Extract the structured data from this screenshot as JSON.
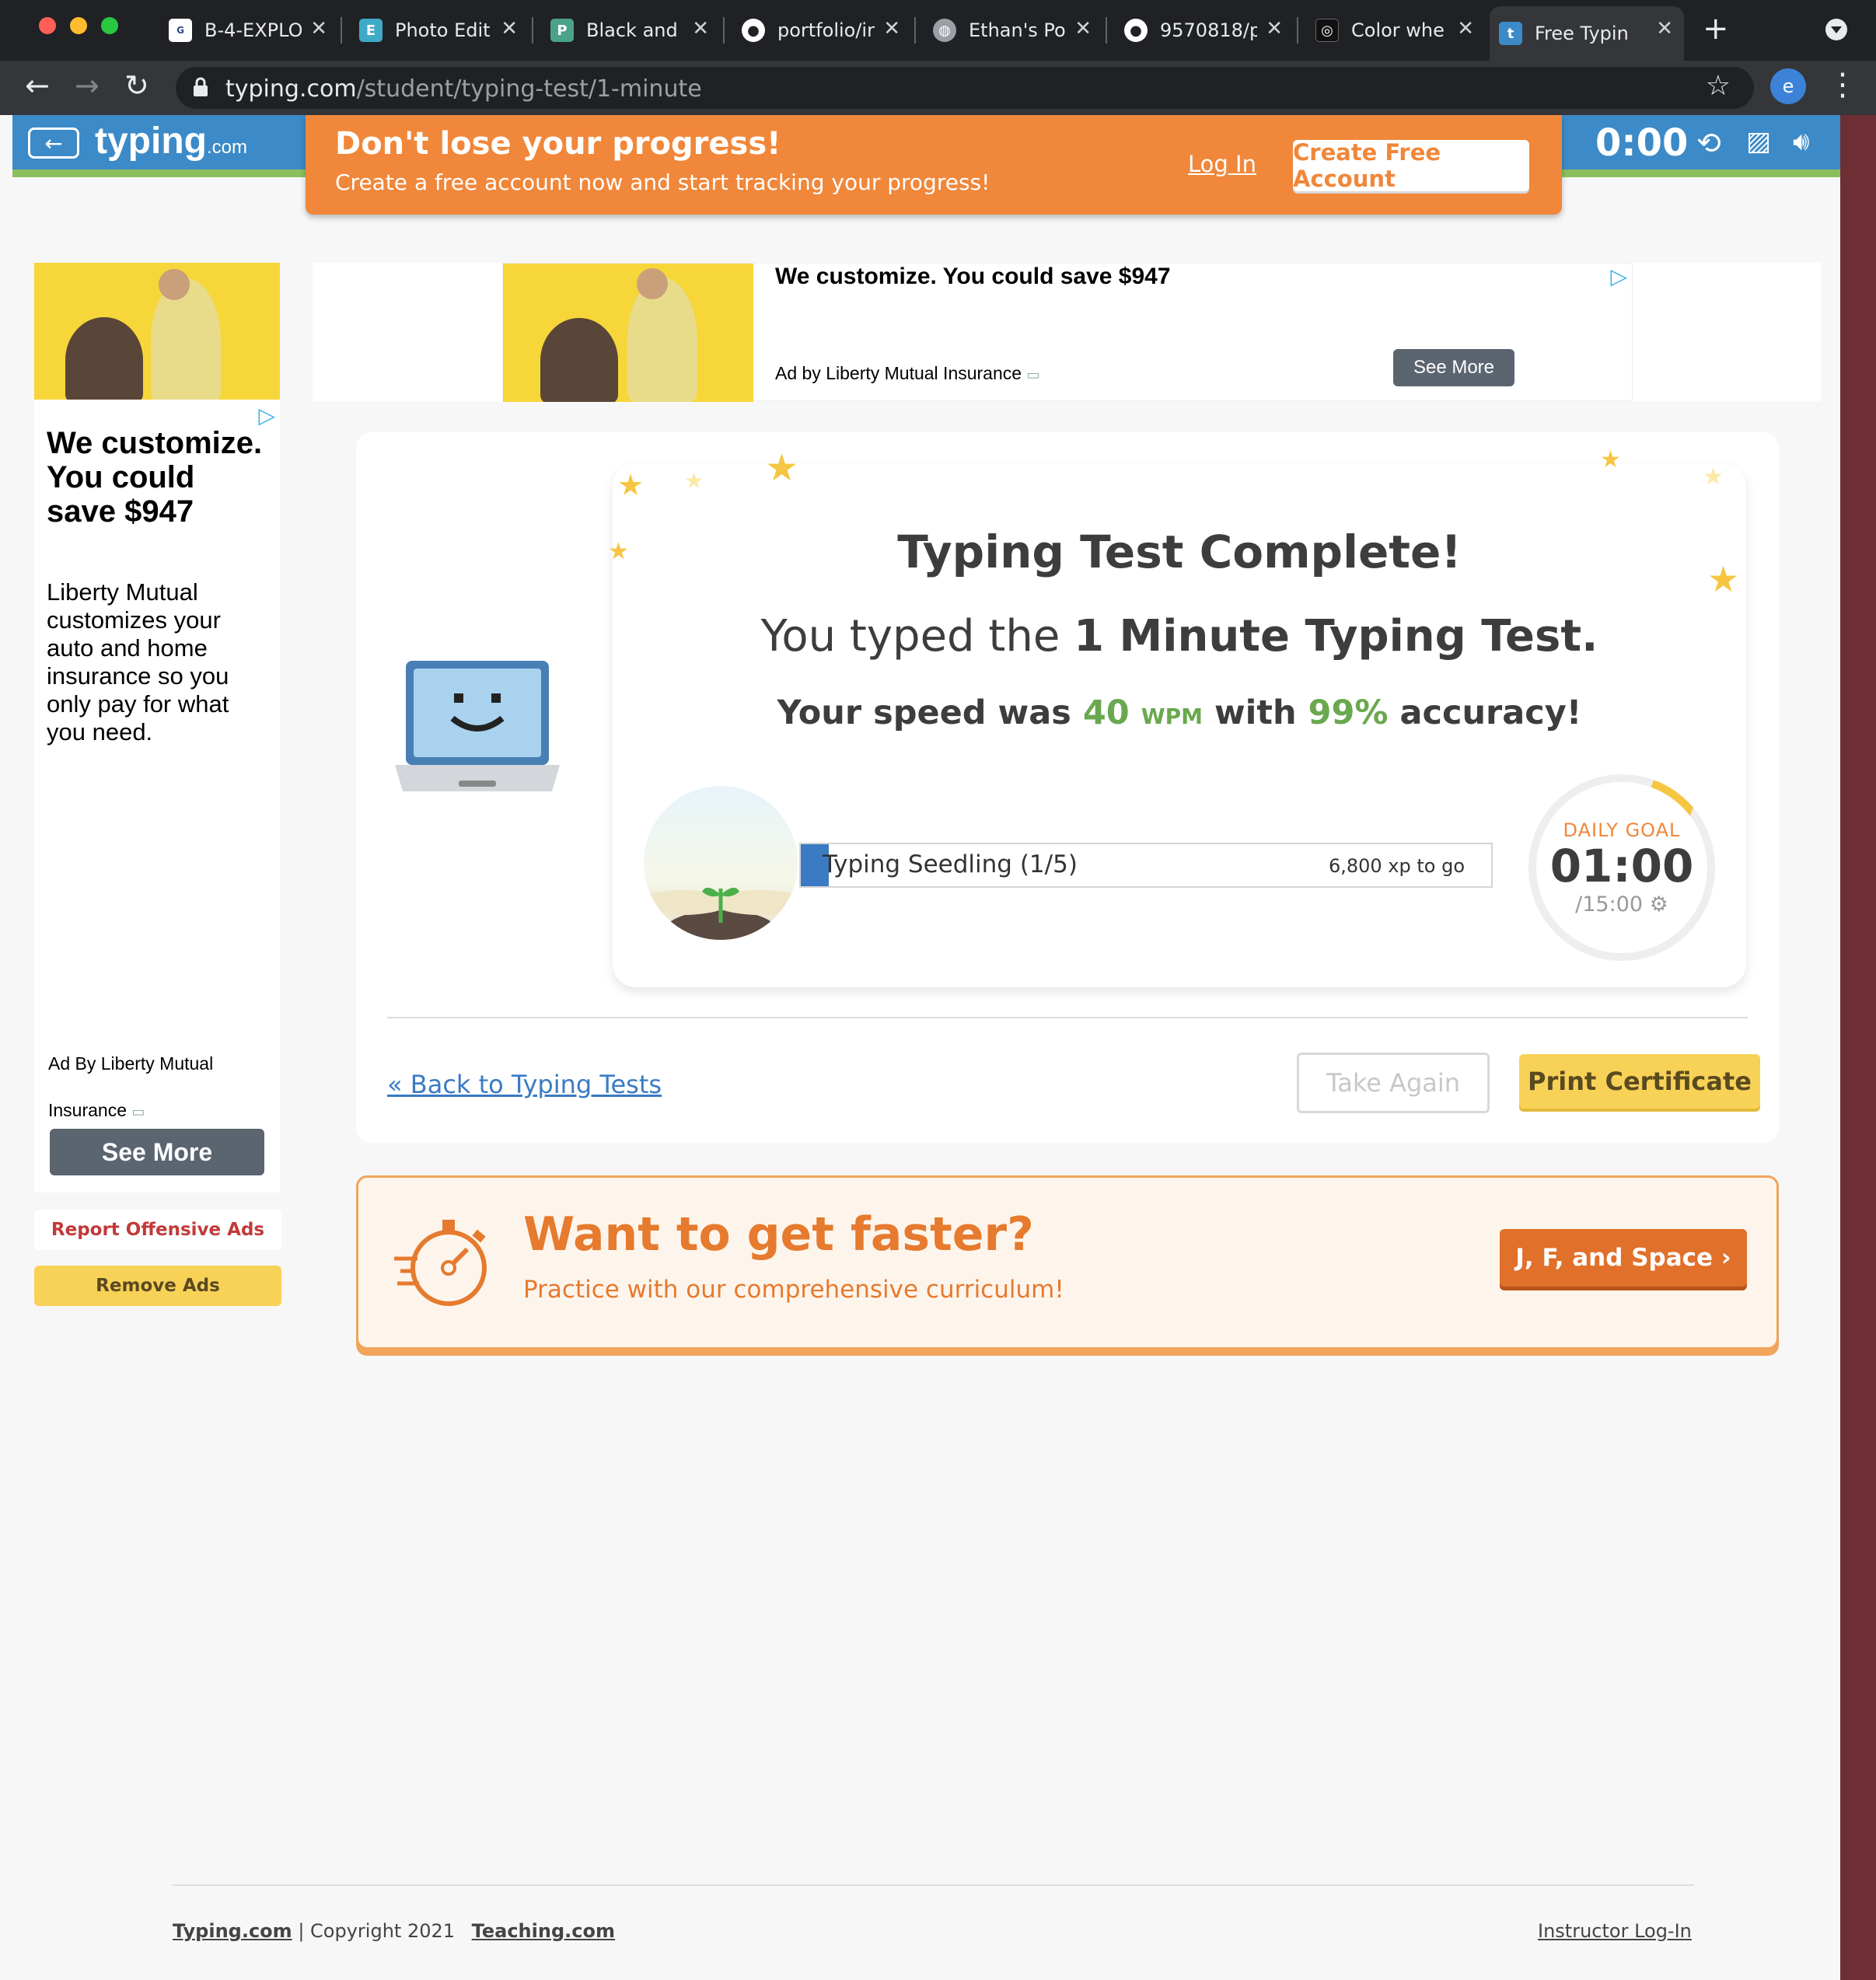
{
  "browser": {
    "tabs": [
      {
        "label": "B-4-EXPLO",
        "icon": "gotw-icon"
      },
      {
        "label": "Photo Edit",
        "icon": "photo-editor-icon"
      },
      {
        "label": "Black and",
        "icon": "p-icon"
      },
      {
        "label": "portfolio/in",
        "icon": "github-icon"
      },
      {
        "label": "Ethan's Po",
        "icon": "globe-icon"
      },
      {
        "label": "9570818/p",
        "icon": "github-icon"
      },
      {
        "label": "Color whe",
        "icon": "color-wheel-icon"
      },
      {
        "label": "Free Typin",
        "icon": "typing-icon",
        "active": true
      }
    ],
    "url_domain": "typing.com",
    "url_path": "/student/typing-test/1-minute",
    "profile_initial": "e"
  },
  "header": {
    "back_icon": "←",
    "logo": "typing",
    "logo_suffix": ".com",
    "timer": "0:00"
  },
  "promo": {
    "title": "Don't lose your progress!",
    "subtitle": "Create a free account now and start tracking your progress!",
    "login": "Log In",
    "create": "Create Free Account"
  },
  "left_ad": {
    "headline": "We customize. You could save $947",
    "body": "Liberty Mutual customizes your auto and home insurance so you only pay for what you need.",
    "by": "Ad By Liberty Mutual Insurance",
    "see_more": "See More"
  },
  "top_ad": {
    "headline": "We customize. You could save $947",
    "by": "Ad by Liberty Mutual Insurance",
    "see_more": "See More"
  },
  "ads": {
    "report": "Report Offensive Ads",
    "remove": "Remove Ads"
  },
  "results": {
    "title": "Typing Test Complete!",
    "sub_prefix": "You typed the ",
    "sub_bold": "1 Minute Typing Test.",
    "speed_prefix": "Your speed was ",
    "speed_value": "40",
    "speed_unit": "WPM",
    "speed_mid": " with ",
    "accuracy": "99%",
    "speed_suffix": " accuracy!",
    "level": "Typing Seedling (1/5)",
    "xp_to_go": "6,800 xp to go",
    "xp_progress": 0.04,
    "goal_label": "DAILY GOAL",
    "goal_time": "01:00",
    "goal_total": "/15:00",
    "goal_progress": 0.067
  },
  "actions": {
    "back": "« Back to Typing Tests",
    "take_again": "Take Again",
    "print": "Print Certificate"
  },
  "faster": {
    "title": "Want to get faster?",
    "subtitle": "Practice with our comprehensive curriculum!",
    "button": "J, F, and Space ›"
  },
  "footer": {
    "site": "Typing.com",
    "copyright": "Copyright 2021",
    "teaching": "Teaching.com",
    "instructor": "Instructor Log-In"
  },
  "colors": {
    "brand_blue": "#3c8ac7",
    "promo_orange": "#f0873a",
    "green": "#6aa84f",
    "yellow": "#f8d257"
  }
}
